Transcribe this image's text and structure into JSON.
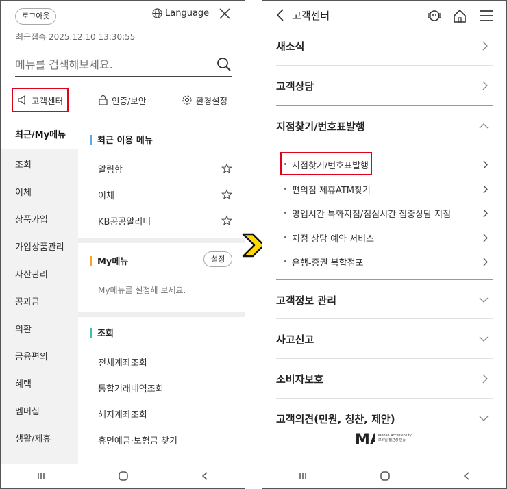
{
  "left": {
    "logout": "로그아웃",
    "language": "Language",
    "last_access": "최근접속  2025.12.10 13:30:55",
    "search_placeholder": "메뉴를 검색해보세요.",
    "quick": {
      "customer_center": "고객센터",
      "auth": "인증/보안",
      "settings": "환경설정"
    },
    "sidebar": [
      "최근/My메뉴",
      "조회",
      "이체",
      "상품가입",
      "가입상품관리",
      "자산관리",
      "공과금",
      "외환",
      "금융편의",
      "혜택",
      "멤버십",
      "생활/제휴"
    ],
    "recent": {
      "title": "최근 이용 메뉴",
      "items": [
        "알림함",
        "이체",
        "KB공공알리미"
      ]
    },
    "my": {
      "title": "My메뉴",
      "set_btn": "설정",
      "msg": "My메뉴를 설정해 보세요."
    },
    "inquiry": {
      "title": "조회",
      "items": [
        "전체계좌조회",
        "통합거래내역조회",
        "해지계좌조회",
        "휴면예금·보험금 찾기"
      ]
    }
  },
  "right": {
    "title": "고객센터",
    "menu_top": [
      "새소식",
      "고객상담"
    ],
    "open_menu": "지점찾기/번호표발행",
    "sub_items": [
      "지점찾기/번호표발행",
      "편의점 제휴ATM찾기",
      "영업시간 특화지점/점심시간 집중상담 지점",
      "지점 상담 예약 서비스",
      "은행-증권 복합점포"
    ],
    "menu_bottom": [
      "고객정보 관리",
      "사고신고",
      "소비자보호",
      "고객의견(민원, 칭찬, 제안)"
    ],
    "logo_line1": "Mobile Accessibility",
    "logo_line2": "모바일 접근성 인증"
  },
  "colors": {
    "highlight": "#e3001b",
    "bar_blue": "#5aa9e6",
    "bar_orange": "#f5a623",
    "bar_teal": "#3bbfb0",
    "arrow": "#ffd800"
  }
}
